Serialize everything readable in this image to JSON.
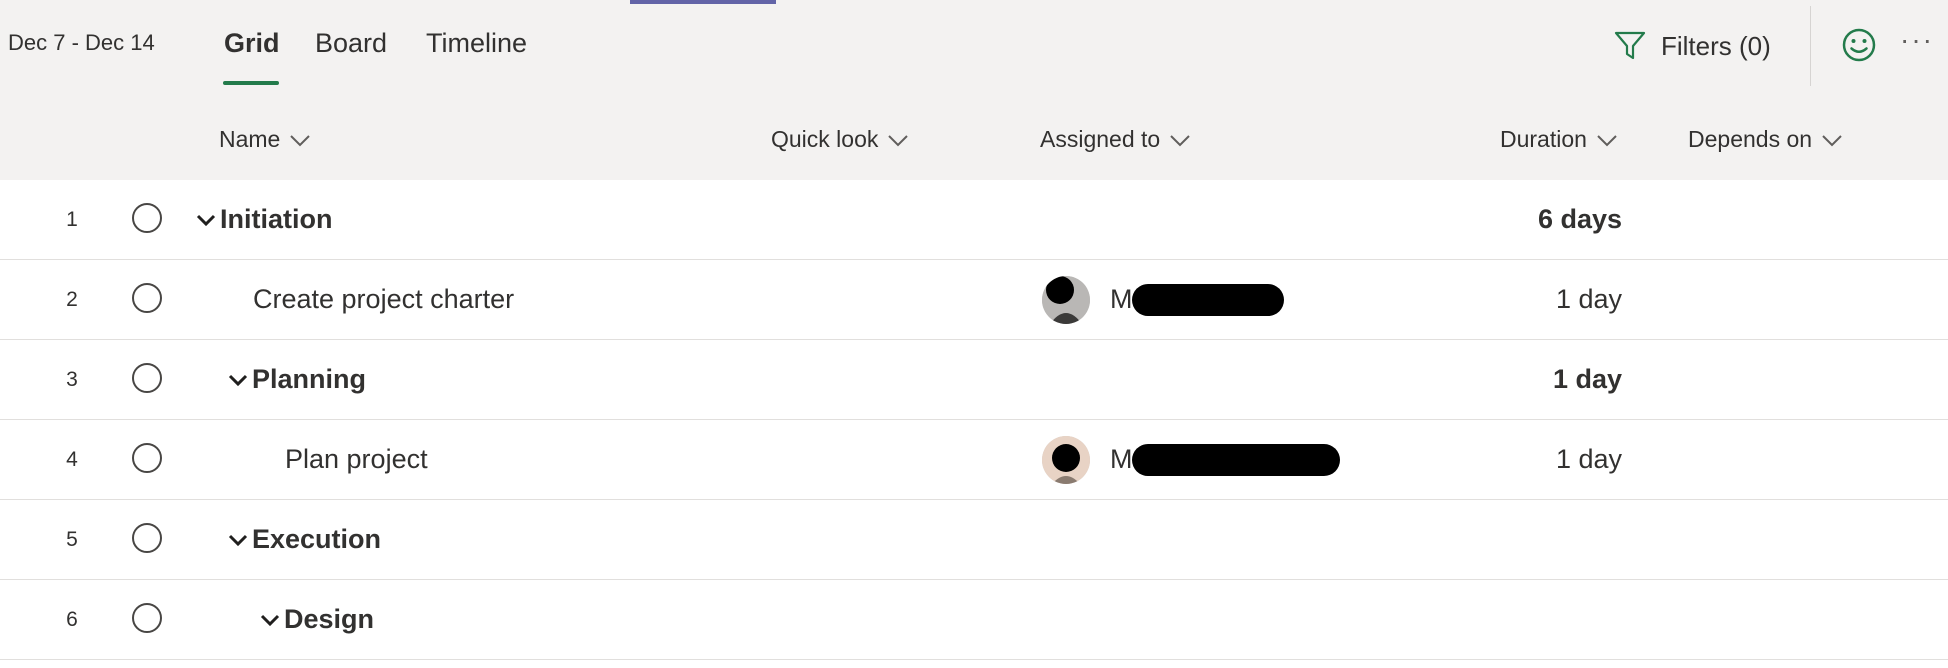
{
  "toolbar": {
    "date_range": "Dec 7 - Dec 14",
    "tabs": [
      {
        "label": "Grid",
        "active": true
      },
      {
        "label": "Board",
        "active": false
      },
      {
        "label": "Timeline",
        "active": false
      }
    ],
    "filters_label": "Filters (0)",
    "more_label": "···"
  },
  "columns": {
    "name": "Name",
    "quick_look": "Quick look",
    "assigned_to": "Assigned to",
    "duration": "Duration",
    "depends_on": "Depends on"
  },
  "rows": [
    {
      "number": "1",
      "name": "Initiation",
      "group": true,
      "assigned": "",
      "duration": "6 days"
    },
    {
      "number": "2",
      "name": "Create project charter",
      "group": false,
      "assigned": "M",
      "duration": "1 day"
    },
    {
      "number": "3",
      "name": "Planning",
      "group": true,
      "assigned": "",
      "duration": "1 day"
    },
    {
      "number": "4",
      "name": "Plan project",
      "group": false,
      "assigned": "M",
      "duration": "1 day"
    },
    {
      "number": "5",
      "name": "Execution",
      "group": true,
      "assigned": "",
      "duration": ""
    },
    {
      "number": "6",
      "name": "Design",
      "group": true,
      "assigned": "",
      "duration": ""
    }
  ],
  "colors": {
    "accent_green": "#237b4b",
    "accent_purple": "#6264a7",
    "header_bg": "#f3f2f1"
  }
}
